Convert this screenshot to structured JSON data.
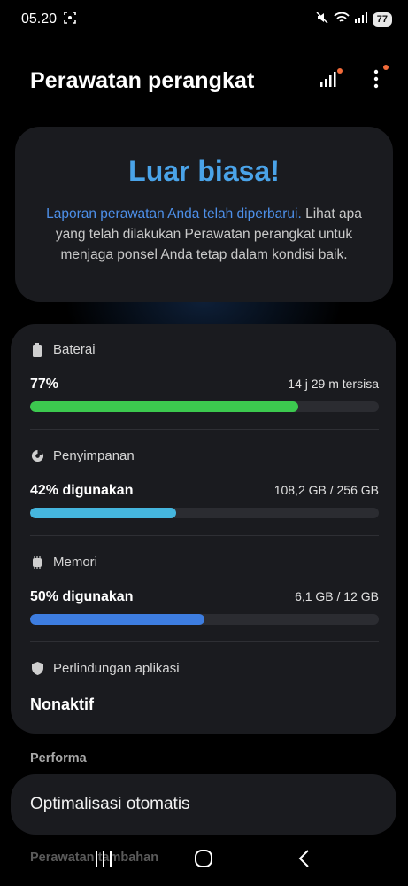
{
  "status_bar": {
    "time": "05.20",
    "battery": "77"
  },
  "header": {
    "title": "Perawatan perangkat"
  },
  "hero": {
    "title": "Luar biasa!",
    "link_text": "Laporan perawatan Anda telah diperbarui.",
    "body_text": " Lihat apa yang telah dilakukan Perawatan perangkat untuk menjaga ponsel Anda tetap dalam kondisi baik."
  },
  "sections": {
    "battery": {
      "label": "Baterai",
      "value": "77%",
      "detail": "14 j 29 m tersisa",
      "percent": 77,
      "color": "#3cc94f"
    },
    "storage": {
      "label": "Penyimpanan",
      "value": "42% digunakan",
      "detail": "108,2 GB / 256 GB",
      "percent": 42,
      "color": "#45b6de"
    },
    "memory": {
      "label": "Memori",
      "value": "50% digunakan",
      "detail": "6,1 GB / 12 GB",
      "percent": 50,
      "color": "#3d7de0"
    },
    "app_protection": {
      "label": "Perlindungan aplikasi",
      "value": "Nonaktif"
    }
  },
  "performance": {
    "heading": "Performa",
    "item": "Optimalisasi otomatis"
  },
  "more": {
    "heading": "Perawatan tambahan"
  },
  "colors": {
    "accent_title": "#4aa3e8",
    "link": "#4d8fe8",
    "notification_dot": "#f26b3a"
  },
  "icons": [
    "signal-icon",
    "more-options-icon",
    "battery-icon",
    "storage-pie-icon",
    "memory-chip-icon",
    "shield-icon",
    "recents-icon",
    "home-icon",
    "back-icon"
  ]
}
